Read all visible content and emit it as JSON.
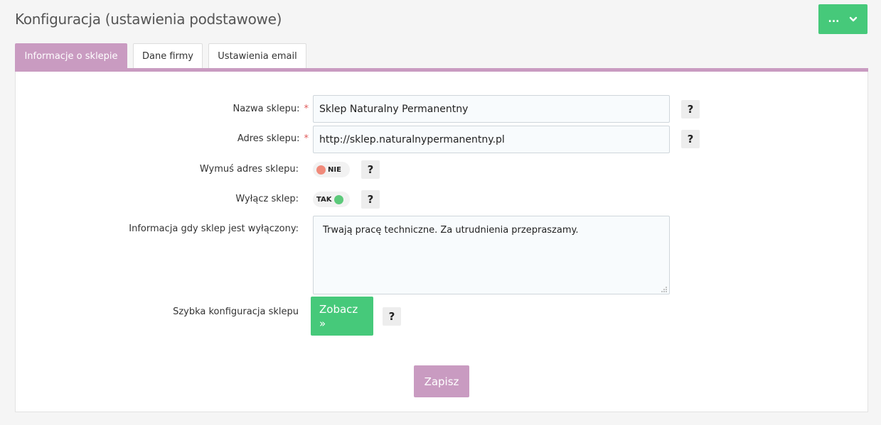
{
  "header": {
    "title": "Konfiguracja (ustawienia podstawowe)",
    "menu_button_label": "..."
  },
  "tabs": [
    {
      "label": "Informacje o sklepie",
      "active": true
    },
    {
      "label": "Dane firmy",
      "active": false
    },
    {
      "label": "Ustawienia email",
      "active": false
    }
  ],
  "form": {
    "shop_name": {
      "label": "Nazwa sklepu:",
      "required_mark": "*",
      "value": "Sklep Naturalny Permanentny"
    },
    "shop_address": {
      "label": "Adres sklepu:",
      "required_mark": "*",
      "value": "http://sklep.naturalnypermanentny.pl"
    },
    "force_address": {
      "label": "Wymuś adres sklepu:",
      "toggle_text": "NIE",
      "state": "off"
    },
    "disable_shop": {
      "label": "Wyłącz sklep:",
      "toggle_text": "TAK",
      "state": "on"
    },
    "disabled_info": {
      "label": "Informacja gdy sklep jest wyłączony:",
      "value": "Trwają pracę techniczne. Za utrudnienia przepraszamy."
    },
    "quick_config": {
      "label": "Szybka konfiguracja sklepu",
      "button_label": "Zobacz »"
    },
    "help_label": "?",
    "save_label": "Zapisz"
  },
  "colors": {
    "accent": "#c99bc1",
    "success": "#46c97a",
    "toggle_off": "#f08a7a",
    "toggle_on": "#5cc97a",
    "required": "#e05a5a"
  },
  "icons": {
    "menu": "chevron-down-icon",
    "help": "question-icon",
    "resize": "resize-grip-icon"
  }
}
